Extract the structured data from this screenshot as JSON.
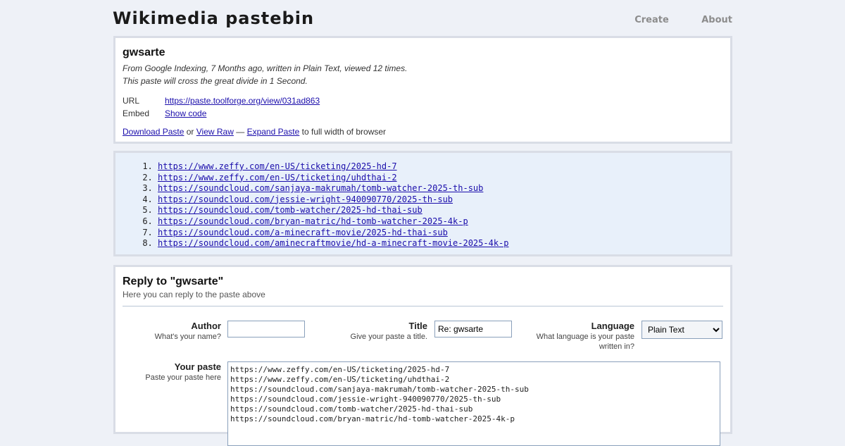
{
  "site": {
    "title": "Wikimedia pastebin",
    "nav": [
      {
        "label": "Create"
      },
      {
        "label": "About"
      }
    ]
  },
  "paste": {
    "title": "gwsarte",
    "meta_line": "From Google Indexing, 7 Months ago, written in Plain Text, viewed 12 times.",
    "expire_line": "This paste will cross the great divide in 1 Second.",
    "url_label": "URL",
    "url": "https://paste.toolforge.org/view/031ad863",
    "embed_label": "Embed",
    "embed_link": "Show code",
    "download_label": "Download Paste",
    "or_text": "or",
    "raw_label": "View Raw",
    "dash_text": "—",
    "expand_label": "Expand Paste",
    "expand_suffix": "to full width of browser"
  },
  "code_lines": [
    "https://www.zeffy.com/en-US/ticketing/2025-hd-7",
    "https://www.zeffy.com/en-US/ticketing/uhdthai-2",
    "https://soundcloud.com/sanjaya-makrumah/tomb-watcher-2025-th-sub",
    "https://soundcloud.com/jessie-wright-940090770/2025-th-sub",
    "https://soundcloud.com/tomb-watcher/2025-hd-thai-sub",
    "https://soundcloud.com/bryan-matric/hd-tomb-watcher-2025-4k-p",
    "https://soundcloud.com/a-minecraft-movie/2025-hd-thai-sub",
    "https://soundcloud.com/aminecraftmovie/hd-a-minecraft-movie-2025-4k-p"
  ],
  "reply": {
    "title": "Reply to \"gwsarte\"",
    "subtitle": "Here you can reply to the paste above",
    "author_label": "Author",
    "author_hint": "What's your name?",
    "author_value": "",
    "title_label": "Title",
    "title_hint": "Give your paste a title.",
    "title_value": "Re: gwsarte",
    "language_label": "Language",
    "language_hint": "What language is your paste written in?",
    "language_value": "Plain Text",
    "paste_label": "Your paste",
    "paste_hint": "Paste your paste here",
    "paste_value": "https://www.zeffy.com/en-US/ticketing/2025-hd-7\nhttps://www.zeffy.com/en-US/ticketing/uhdthai-2\nhttps://soundcloud.com/sanjaya-makrumah/tomb-watcher-2025-th-sub\nhttps://soundcloud.com/jessie-wright-940090770/2025-th-sub\nhttps://soundcloud.com/tomb-watcher/2025-hd-thai-sub\nhttps://soundcloud.com/bryan-matric/hd-tomb-watcher-2025-4k-p"
  }
}
